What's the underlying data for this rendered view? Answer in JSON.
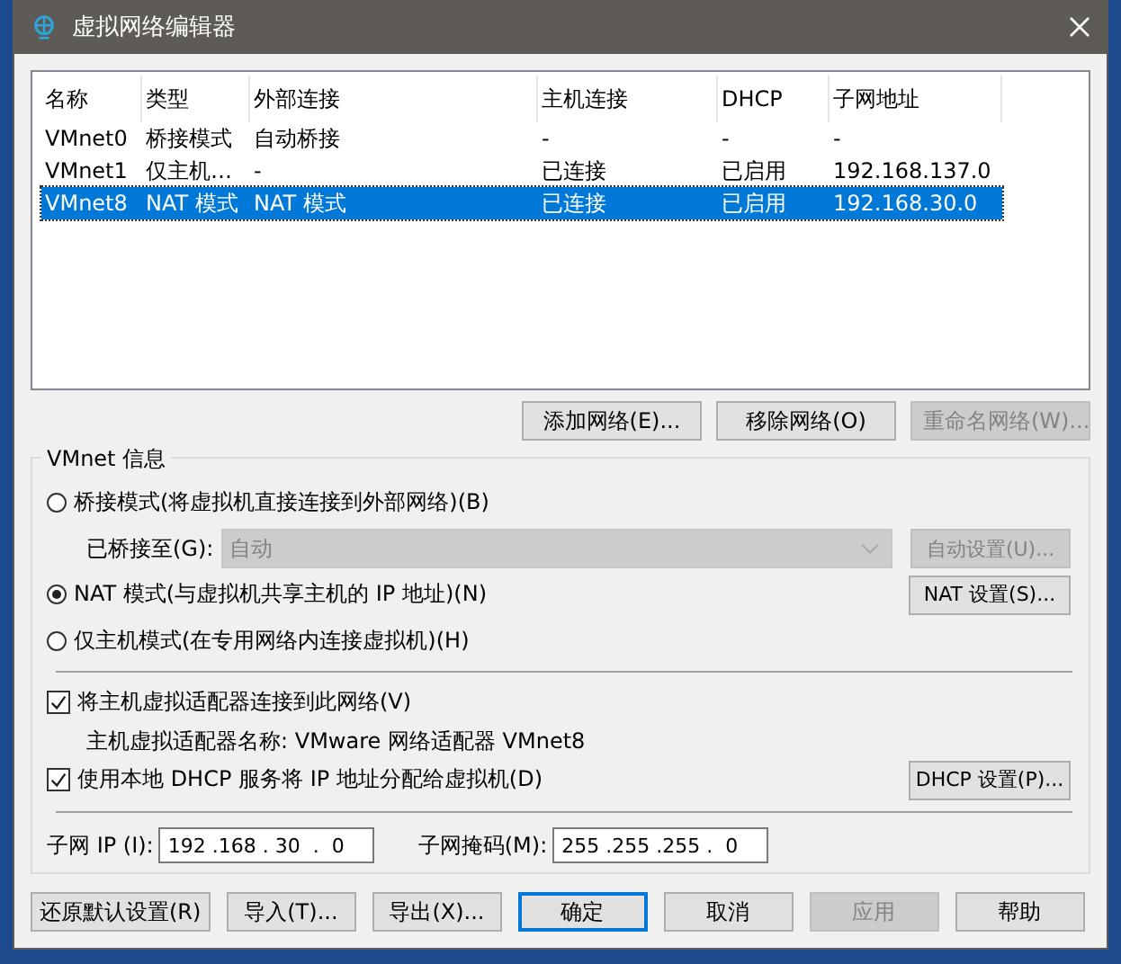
{
  "window": {
    "title": "虚拟网络编辑器"
  },
  "table": {
    "columns": [
      "名称",
      "类型",
      "外部连接",
      "主机连接",
      "DHCP",
      "子网地址"
    ],
    "rows": [
      {
        "cells": [
          "VMnet0",
          "桥接模式",
          "自动桥接",
          "-",
          "-",
          "-"
        ],
        "selected": false
      },
      {
        "cells": [
          "VMnet1",
          "仅主机…",
          "-",
          "已连接",
          "已启用",
          "192.168.137.0"
        ],
        "selected": false
      },
      {
        "cells": [
          "VMnet8",
          "NAT 模式",
          "NAT 模式",
          "已连接",
          "已启用",
          "192.168.30.0"
        ],
        "selected": true
      }
    ]
  },
  "list_buttons": [
    {
      "label": "添加网络(E)...",
      "disabled": false
    },
    {
      "label": "移除网络(O)",
      "disabled": false
    },
    {
      "label": "重命名网络(W)...",
      "disabled": true
    }
  ],
  "vmnet_info": {
    "title": "VMnet 信息",
    "bridge_mode": {
      "label": "桥接模式(将虚拟机直接连接到外部网络)(B)",
      "selected": false
    },
    "bridged_to": {
      "label": "已桥接至(G):",
      "value": "自动",
      "disabled": true
    },
    "auto_settings": {
      "label": "自动设置(U)...",
      "disabled": true
    },
    "nat_mode": {
      "label": "NAT 模式(与虚拟机共享主机的 IP 地址)(N)",
      "selected": true
    },
    "nat_settings": {
      "label": "NAT 设置(S)...",
      "disabled": false
    },
    "host_only": {
      "label": "仅主机模式(在专用网络内连接虚拟机)(H)",
      "selected": false
    },
    "connect_adapter": {
      "label": "将主机虚拟适配器连接到此网络(V)",
      "checked": true
    },
    "adapter_name": "主机虚拟适配器名称: VMware 网络适配器 VMnet8",
    "use_dhcp": {
      "label": "使用本地 DHCP 服务将 IP 地址分配给虚拟机(D)",
      "checked": true
    },
    "dhcp_settings": {
      "label": "DHCP 设置(P)...",
      "disabled": false
    },
    "subnet_ip": {
      "label": "子网 IP (I):",
      "value": "192 .168 . 30  .  0"
    },
    "subnet_mask": {
      "label": "子网掩码(M):",
      "value": "255 .255 .255 .  0"
    }
  },
  "footer_buttons": [
    {
      "label": "还原默认设置(R)",
      "default": false,
      "disabled": false
    },
    {
      "label": "导入(T)...",
      "default": false,
      "disabled": false
    },
    {
      "label": "导出(X)...",
      "default": false,
      "disabled": false
    },
    {
      "label": "确定",
      "default": true,
      "disabled": false
    },
    {
      "label": "取消",
      "default": false,
      "disabled": false
    },
    {
      "label": "应用",
      "default": false,
      "disabled": true
    },
    {
      "label": "帮助",
      "default": false,
      "disabled": false
    }
  ]
}
